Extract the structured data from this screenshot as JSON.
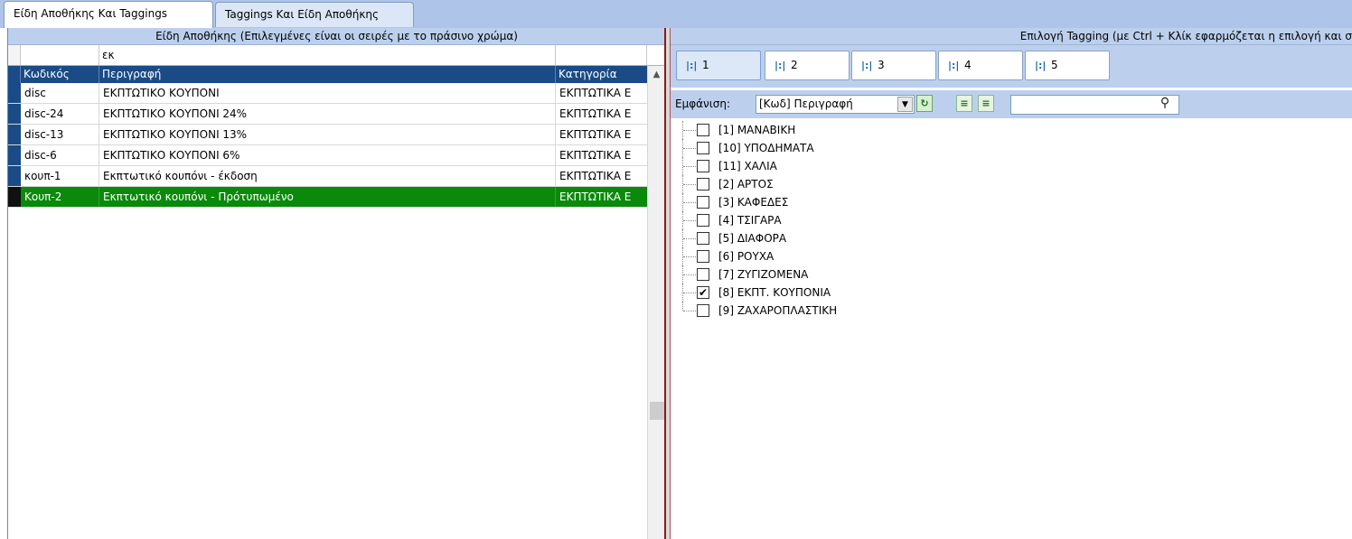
{
  "tabs": [
    {
      "label": "Είδη Αποθήκης Και Taggings",
      "active": true
    },
    {
      "label": "Taggings Και Είδη Αποθήκης",
      "active": false
    }
  ],
  "left": {
    "title": "Είδη Αποθήκης  (Επιλεγμένες είναι οι σειρές με το πράσινο χρώμα)",
    "filter": {
      "code": "",
      "description": "εκ",
      "category": ""
    },
    "columns": [
      "Κωδικός",
      "Περιγραφή",
      "Κατηγορία"
    ],
    "rows": [
      {
        "code": "disc",
        "description": "ΕΚΠΤΩΤΙΚΟ ΚΟΥΠΟΝΙ",
        "category": "ΕΚΠΤΩΤΙΚΑ Ε",
        "selected": false
      },
      {
        "code": "disc-24",
        "description": "ΕΚΠΤΩΤΙΚΟ ΚΟΥΠΟΝΙ 24%",
        "category": "ΕΚΠΤΩΤΙΚΑ Ε",
        "selected": false
      },
      {
        "code": "disc-13",
        "description": "ΕΚΠΤΩΤΙΚΟ ΚΟΥΠΟΝΙ 13%",
        "category": "ΕΚΠΤΩΤΙΚΑ Ε",
        "selected": false
      },
      {
        "code": "disc-6",
        "description": "ΕΚΠΤΩΤΙΚΟ ΚΟΥΠΟΝΙ 6%",
        "category": "ΕΚΠΤΩΤΙΚΑ Ε",
        "selected": false
      },
      {
        "code": "κουπ-1",
        "description": "Εκπτωτικό κουπόνι - έκδοση",
        "category": "ΕΚΠΤΩΤΙΚΑ Ε",
        "selected": false
      },
      {
        "code": "Κουπ-2",
        "description": "Εκπτωτικό κουπόνι - Πρότυπωμένο",
        "category": "ΕΚΠΤΩΤΙΚΑ Ε",
        "selected": true
      }
    ],
    "selected_color": "#0a8a0a",
    "header_color": "#1a4b86"
  },
  "right": {
    "title": "Επιλογή Tagging  (με Ctrl + Κλίκ εφαρμόζεται η επιλογή και σ",
    "level_buttons": [
      "1",
      "2",
      "3",
      "4",
      "5"
    ],
    "display_label": "Εμφάνιση:",
    "display_value": "[Κωδ] Περιγραφή",
    "search_value": "",
    "tree": [
      {
        "label": "[1]  ΜΑΝΑΒΙΚΗ",
        "checked": false
      },
      {
        "label": "[10]  ΥΠΟΔΗΜΑΤΑ",
        "checked": false
      },
      {
        "label": "[11]  ΧΑΛΙΑ",
        "checked": false
      },
      {
        "label": "[2]  ΑΡΤΟΣ",
        "checked": false
      },
      {
        "label": "[3]  ΚΑΦΕΔΕΣ",
        "checked": false
      },
      {
        "label": "[4]  ΤΣΙΓΑΡΑ",
        "checked": false
      },
      {
        "label": "[5]  ΔΙΑΦΟΡΑ",
        "checked": false
      },
      {
        "label": "[6]  ΡΟΥΧΑ",
        "checked": false
      },
      {
        "label": "[7]  ΖΥΓΙΖΟΜΕΝΑ",
        "checked": false
      },
      {
        "label": "[8]  ΕΚΠΤ. ΚΟΥΠΟΝΙΑ",
        "checked": true
      },
      {
        "label": "[9]  ΖΑΧΑΡΟΠΛΑΣΤΙΚΗ",
        "checked": false
      }
    ],
    "icons": [
      "level-tree-icon",
      "refresh-icon",
      "expand-all-icon",
      "collapse-all-icon",
      "search-icon",
      "dropdown-arrow-icon"
    ]
  },
  "colors": {
    "panel_header": "#bcd0ee",
    "tab_strip": "#aec4e8",
    "splitter_accent": "#8b1a1a"
  }
}
